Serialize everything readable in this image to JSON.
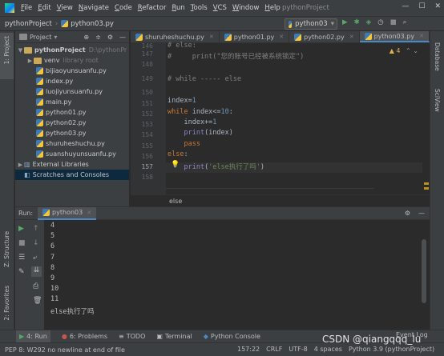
{
  "menu": {
    "items": [
      {
        "u": "F",
        "rest": "ile"
      },
      {
        "u": "E",
        "rest": "dit"
      },
      {
        "u": "V",
        "rest": "iew"
      },
      {
        "u": "N",
        "rest": "avigate"
      },
      {
        "u": "C",
        "rest": "ode"
      },
      {
        "u": "R",
        "rest": "efactor"
      },
      {
        "u": "R",
        "rest": "un"
      },
      {
        "u": "T",
        "rest": "ools"
      },
      {
        "u": "V",
        "rest": "CS"
      },
      {
        "u": "W",
        "rest": "indow"
      },
      {
        "u": "H",
        "rest": "elp"
      }
    ],
    "project_title": "pythonProject",
    "window_buttons": [
      "—",
      "☐",
      "✕"
    ]
  },
  "navbar": {
    "project": "pythonProject",
    "file": "python03.py",
    "run_config": "python03"
  },
  "left_strip": {
    "project_label": "1: Project",
    "structure_label": "Z: Structure",
    "favorites_label": "2: Favorites"
  },
  "right_strip": {
    "database_label": "Database",
    "sciview_label": "SciView"
  },
  "project_panel": {
    "title": "Project",
    "root": {
      "name": "pythonProject",
      "path": "D:\\pythonPr"
    },
    "venv": {
      "name": "venv",
      "hint": "library root"
    },
    "files": [
      "bijiaoyunsuanfu.py",
      "index.py",
      "luojiyunsuanfu.py",
      "main.py",
      "python01.py",
      "python02.py",
      "python03.py",
      "shuruheshuchu.py",
      "suanshuyunsuanfu.py"
    ],
    "external": "External Libraries",
    "scratches": "Scratches and Consoles"
  },
  "editor": {
    "tabs": [
      "shuruheshuchu.py",
      "python01.py",
      "python02.py",
      "python03.py"
    ],
    "active_tab": "python03.py",
    "warning_count": "4",
    "line_numbers": [
      "146",
      "147",
      "148",
      "149",
      "150",
      "151",
      "152",
      "153",
      "154",
      "155",
      "156",
      "157",
      "158"
    ],
    "lines": {
      "l146": "# else:",
      "l147a": "#     print(",
      "l147b": "\"您的账号已经被系统锁定\"",
      "l147c": ")",
      "l149": "# while ----- else",
      "l151a": "index=",
      "l151b": "1",
      "l152a": "while",
      "l152b": " index<=",
      "l152c": "10",
      "l152d": ":",
      "l153a": "    index+=",
      "l153b": "1",
      "l154a": "    ",
      "l154b": "print",
      "l154c": "(index)",
      "l155": "    pass",
      "l156a": "else",
      "l156b": ":",
      "l157a": "    ",
      "l157b": "print",
      "l157c": "(",
      "l157d": "'else执行了吗'",
      "l157e": ")"
    },
    "breadcrumb": "else"
  },
  "run_panel": {
    "label": "Run:",
    "tab": "python03",
    "output": [
      "4",
      "5",
      "6",
      "7",
      "8",
      "9",
      "10",
      "11",
      "else执行了吗"
    ]
  },
  "bottom_tools": [
    {
      "icon": "▶",
      "label": "4: Run"
    },
    {
      "icon": "●",
      "label": "6: Problems"
    },
    {
      "icon": "≡",
      "label": "TODO"
    },
    {
      "icon": "▣",
      "label": "Terminal"
    },
    {
      "icon": "◆",
      "label": "Python Console"
    }
  ],
  "event_log": "Event Log",
  "status": {
    "message": "PEP 8: W292 no newline at end of file",
    "position": "157:22",
    "line_sep": "CRLF",
    "encoding": "UTF-8",
    "indent": "4 spaces",
    "interpreter": "Python 3.9 (pythonProject)"
  },
  "watermark": "CSDN @qiangqqq_lu"
}
